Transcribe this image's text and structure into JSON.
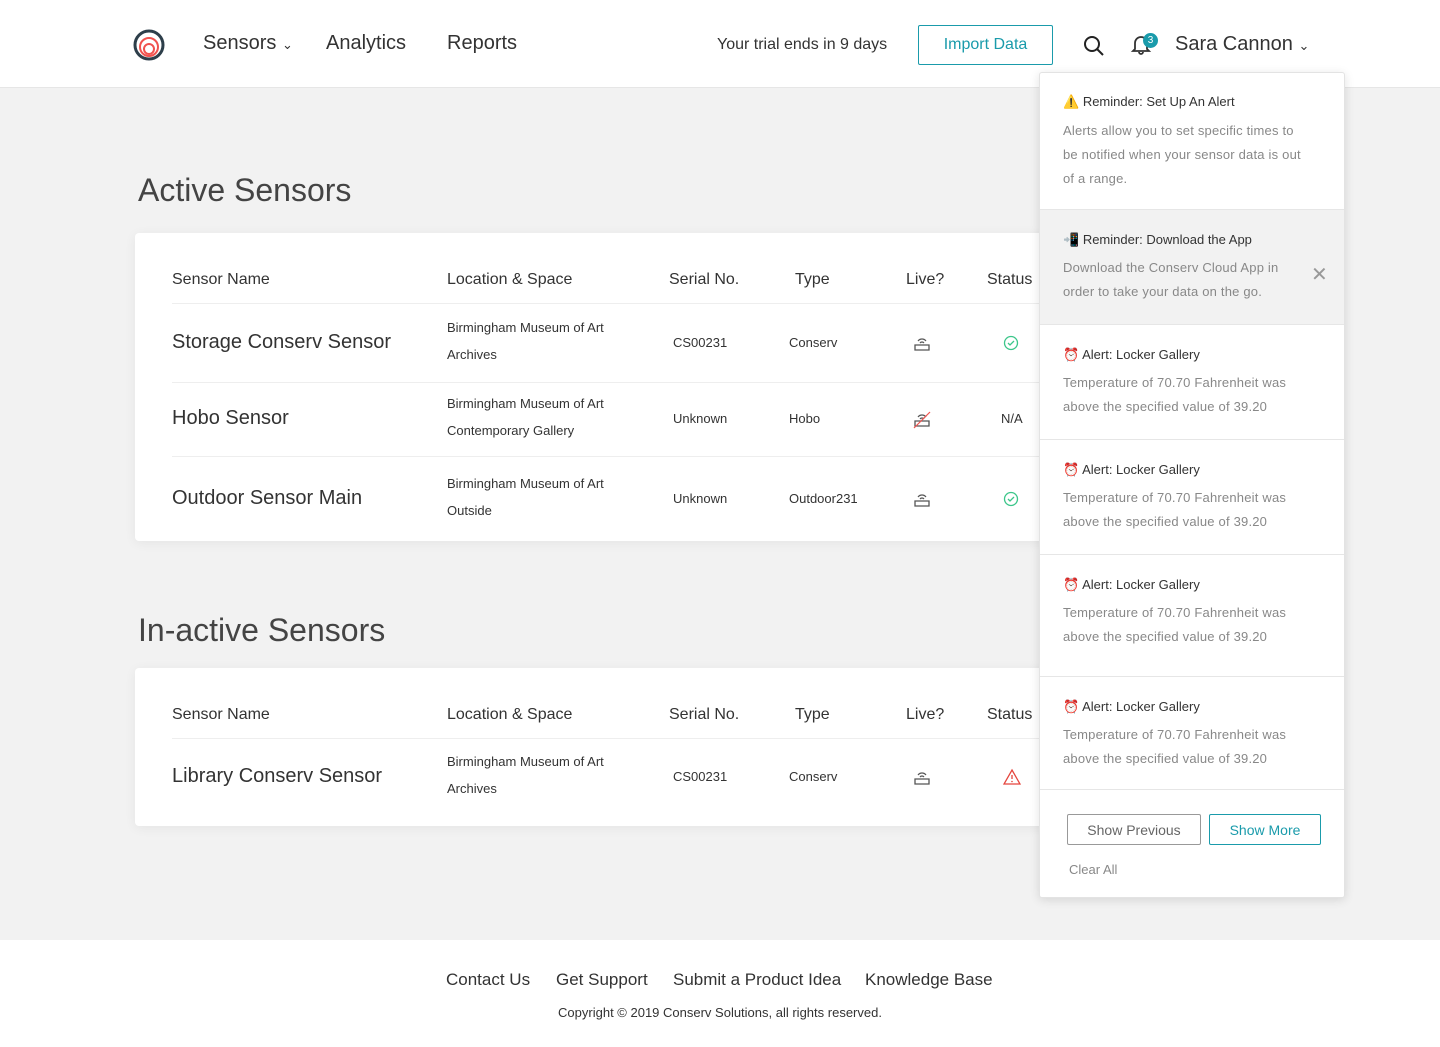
{
  "header": {
    "nav": [
      "Sensors",
      "Analytics",
      "Reports"
    ],
    "trial_text": "Your trial ends in 9 days",
    "import_label": "Import Data",
    "notification_count": "3",
    "user_name": "Sara Cannon"
  },
  "active": {
    "title": "Active Sensors",
    "columns": [
      "Sensor Name",
      "Location & Space",
      "Serial No.",
      "Type",
      "Live?",
      "Status"
    ],
    "rows": [
      {
        "name": "Storage Conserv Sensor",
        "loc1": "Birmingham Museum of Art",
        "loc2": "Archives",
        "serial": "CS00231",
        "type": "Conserv",
        "live": true,
        "status": "ok"
      },
      {
        "name": "Hobo Sensor",
        "loc1": "Birmingham Museum of Art",
        "loc2": "Contemporary Gallery",
        "serial": "Unknown",
        "type": "Hobo",
        "live": false,
        "status": "N/A"
      },
      {
        "name": "Outdoor Sensor Main",
        "loc1": "Birmingham Museum of Art",
        "loc2": "Outside",
        "serial": "Unknown",
        "type": "Outdoor231",
        "live": true,
        "status": "ok"
      }
    ]
  },
  "inactive": {
    "title": "In-active Sensors",
    "columns": [
      "Sensor Name",
      "Location & Space",
      "Serial No.",
      "Type",
      "Live?",
      "Status"
    ],
    "rows": [
      {
        "name": "Library Conserv Sensor",
        "loc1": "Birmingham Museum of Art",
        "loc2": "Archives",
        "serial": "CS00231",
        "type": "Conserv",
        "live": true,
        "status": "warning"
      }
    ]
  },
  "notifications": {
    "items": [
      {
        "icon": "⚠️",
        "title": "Reminder: Set Up An Alert",
        "body": "Alerts allow you to set specific times to be notified when your sensor data is out of a range."
      },
      {
        "icon": "📲",
        "title": "Reminder: Download the App",
        "body": "Download the Conserv Cloud App in order to take your data on the go."
      },
      {
        "icon": "⏰",
        "title": "Alert: Locker Gallery",
        "body": "Temperature of 70.70 Fahrenheit was above the specified value of 39.20"
      },
      {
        "icon": "⏰",
        "title": "Alert: Locker Gallery",
        "body": "Temperature of 70.70 Fahrenheit was above the specified value of 39.20"
      },
      {
        "icon": "⏰",
        "title": "Alert: Locker Gallery",
        "body": "Temperature of 70.70 Fahrenheit was above the specified value of 39.20"
      },
      {
        "icon": "⏰",
        "title": "Alert: Locker Gallery",
        "body": "Temperature of 70.70 Fahrenheit was above the specified value of 39.20"
      }
    ],
    "show_previous": "Show Previous",
    "show_more": "Show More",
    "clear_all": "Clear All"
  },
  "footer": {
    "links": [
      "Contact Us",
      "Get Support",
      "Submit a Product Idea",
      "Knowledge Base"
    ],
    "copyright": "Copyright © 2019 Conserv Solutions, all rights reserved."
  },
  "colors": {
    "accent": "#1a9bab",
    "ok": "#3cc68a",
    "warning": "#e5453d"
  }
}
